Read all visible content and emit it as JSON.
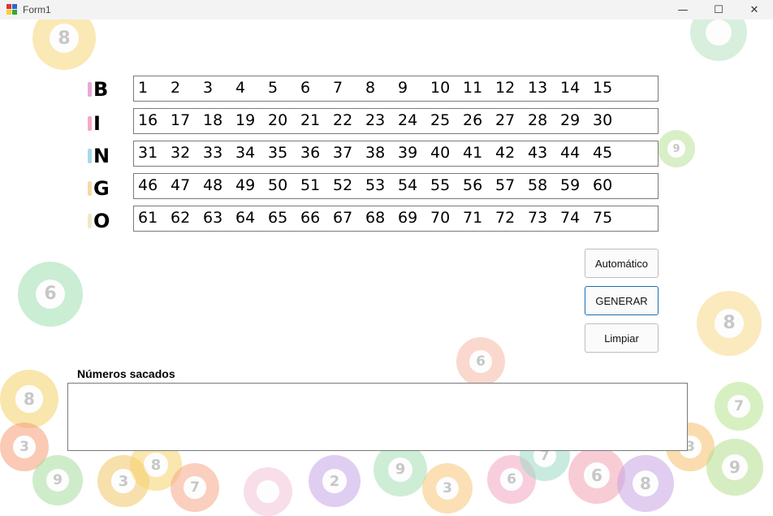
{
  "window": {
    "title": "Form1",
    "controls": {
      "minimize": "—",
      "maximize": "☐",
      "close": "✕"
    }
  },
  "bingo": {
    "letters": [
      "B",
      "I",
      "N",
      "G",
      "O"
    ],
    "letter_colors": [
      "#e8a8d8",
      "#f4a8c8",
      "#a8d8e8",
      "#f8d8a8",
      "#f0e8c8"
    ],
    "rows": [
      [
        "1",
        "2",
        "3",
        "4",
        "5",
        "6",
        "7",
        "8",
        "9",
        "10",
        "11",
        "12",
        "13",
        "14",
        "15"
      ],
      [
        "16",
        "17",
        "18",
        "19",
        "20",
        "21",
        "22",
        "23",
        "24",
        "25",
        "26",
        "27",
        "28",
        "29",
        "30"
      ],
      [
        "31",
        "32",
        "33",
        "34",
        "35",
        "36",
        "37",
        "38",
        "39",
        "40",
        "41",
        "42",
        "43",
        "44",
        "45"
      ],
      [
        "46",
        "47",
        "48",
        "49",
        "50",
        "51",
        "52",
        "53",
        "54",
        "55",
        "56",
        "57",
        "58",
        "59",
        "60"
      ],
      [
        "61",
        "62",
        "63",
        "64",
        "65",
        "66",
        "67",
        "68",
        "69",
        "70",
        "71",
        "72",
        "73",
        "74",
        "75"
      ]
    ]
  },
  "buttons": {
    "auto_label": "Automático",
    "generate_label": "GENERAR",
    "clear_label": "Limpiar"
  },
  "output": {
    "label": "Números sacados",
    "value": ""
  },
  "background_balls": [
    {
      "number": "8",
      "color": "#f6d77a"
    },
    {
      "number": "9",
      "color": "#b9e39a"
    },
    {
      "number": "6",
      "color": "#9fe0b0"
    },
    {
      "number": "8",
      "color": "#f6d98a"
    },
    {
      "number": "6",
      "color": "#f6b9a5"
    },
    {
      "number": "8",
      "color": "#f4d36a"
    },
    {
      "number": "3",
      "color": "#f6a07a"
    },
    {
      "number": "9",
      "color": "#a9dda0"
    },
    {
      "number": "3",
      "color": "#f2c76a"
    },
    {
      "number": "8",
      "color": "#f7d46d"
    },
    {
      "number": "7",
      "color": "#b7e48f"
    },
    {
      "number": "6",
      "color": "#f3a4b3"
    },
    {
      "number": "2",
      "color": "#c8a6e8"
    },
    {
      "number": "9",
      "color": "#a7dfb3"
    },
    {
      "number": "3",
      "color": "#f8c77a"
    },
    {
      "number": "6",
      "color": "#f4a7c4"
    },
    {
      "number": "7",
      "color": "#9edbc6"
    },
    {
      "number": "3",
      "color": "#f6c16e"
    },
    {
      "number": "9",
      "color": "#b5e08f"
    },
    {
      "number": "7",
      "color": "#f7a88a"
    },
    {
      "number": "8",
      "color": "#c7a5e5"
    },
    {
      "number": "",
      "color": "#f2c4d8"
    },
    {
      "number": "",
      "color": "#b8e3c0"
    }
  ]
}
